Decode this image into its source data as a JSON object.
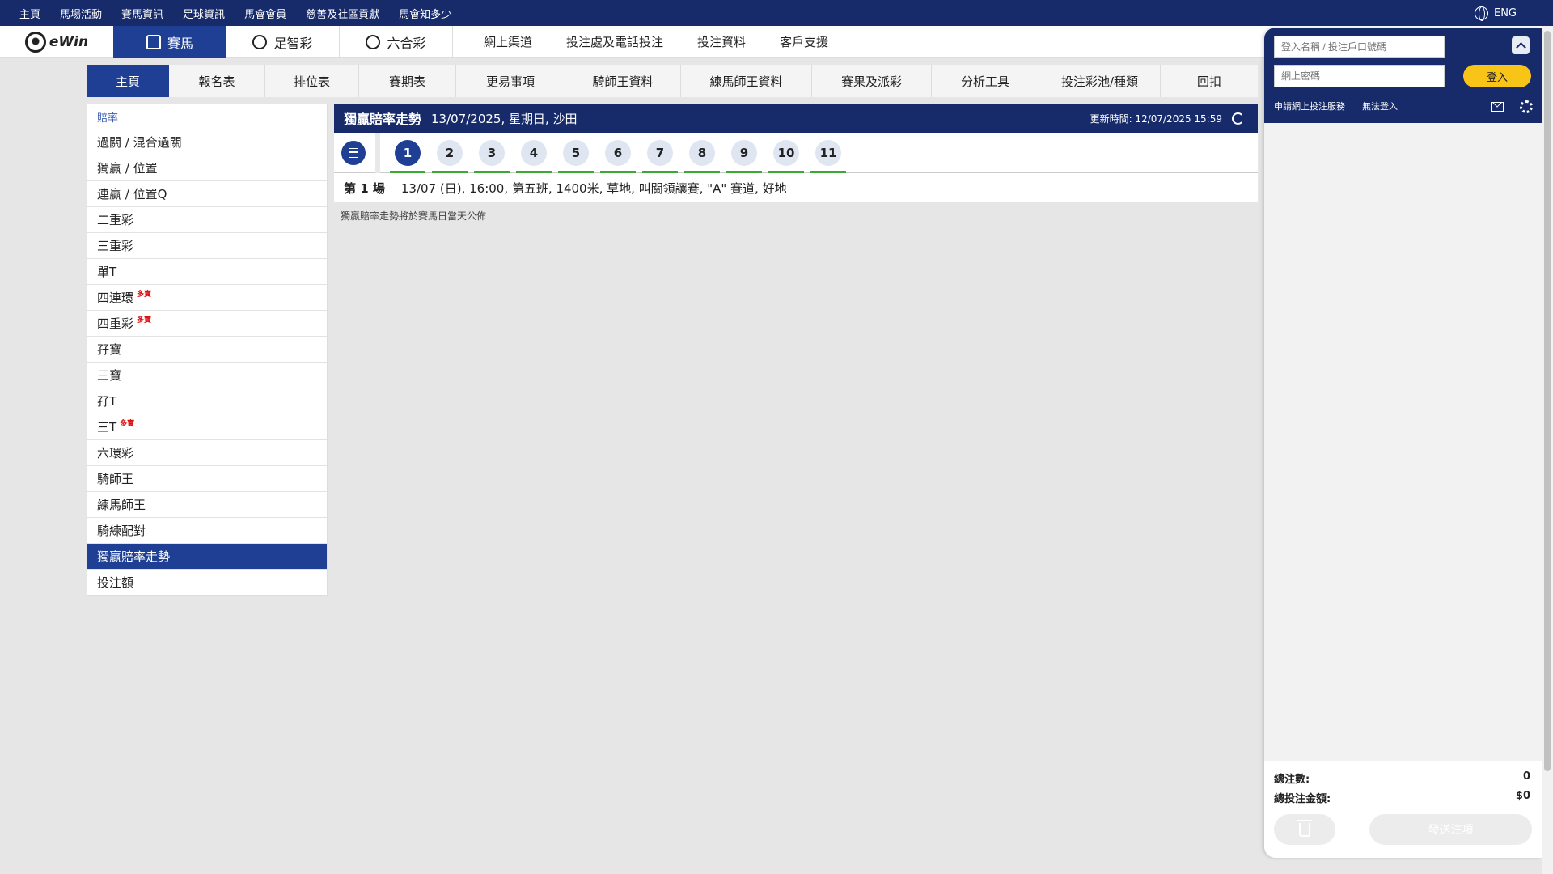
{
  "topnav": {
    "links": [
      "主頁",
      "馬場活動",
      "賽馬資訊",
      "足球資訊",
      "馬會會員",
      "慈善及社區貢獻",
      "馬會知多少"
    ],
    "lang": "ENG"
  },
  "product": {
    "logo_text": "eWin",
    "tabs": [
      "賽馬",
      "足智彩",
      "六合彩"
    ],
    "links": [
      "網上渠道",
      "投注處及電話投注",
      "投注資料",
      "客戶支援"
    ]
  },
  "subnav": [
    "主頁",
    "報名表",
    "排位表",
    "賽期表",
    "更易事項",
    "騎師王資料",
    "練馬師王資料",
    "賽果及派彩",
    "分析工具",
    "投注彩池/種類",
    "回扣"
  ],
  "sidebar": {
    "heading": "賠率",
    "items": [
      {
        "label": "過關 / 混合過關",
        "badge": ""
      },
      {
        "label": "獨贏 / 位置",
        "badge": ""
      },
      {
        "label": "連贏 / 位置Q",
        "badge": ""
      },
      {
        "label": "二重彩",
        "badge": ""
      },
      {
        "label": "三重彩",
        "badge": ""
      },
      {
        "label": "單T",
        "badge": ""
      },
      {
        "label": "四連環",
        "badge": "多寶"
      },
      {
        "label": "四重彩",
        "badge": "多寶"
      },
      {
        "label": "孖寶",
        "badge": ""
      },
      {
        "label": "三寶",
        "badge": ""
      },
      {
        "label": "孖T",
        "badge": ""
      },
      {
        "label": "三T",
        "badge": "多寶"
      },
      {
        "label": "六環彩",
        "badge": ""
      },
      {
        "label": "騎師王",
        "badge": ""
      },
      {
        "label": "練馬師王",
        "badge": ""
      },
      {
        "label": "騎練配對",
        "badge": ""
      },
      {
        "label": "獨贏賠率走勢",
        "badge": ""
      },
      {
        "label": "投注額",
        "badge": ""
      }
    ]
  },
  "panel": {
    "title": "獨贏賠率走勢",
    "date": "13/07/2025, 星期日, 沙田",
    "update_label": "更新時間: 12/07/2025 15:59",
    "races": [
      "1",
      "2",
      "3",
      "4",
      "5",
      "6",
      "7",
      "8",
      "9",
      "10",
      "11"
    ],
    "active_race": "1",
    "race_no": "第 1 場",
    "race_desc": "13/07 (日), 16:00, 第五班, 1400米, 草地, 叫關領讓賽, \"A\" 賽道, 好地",
    "note": "獨贏賠率走勢將於賽馬日當天公佈"
  },
  "login": {
    "username_placeholder": "登入名稱 / 投注戶口號碼",
    "password_placeholder": "網上密碼",
    "login_label": "登入",
    "apply_link": "申請網上投注服務",
    "cant_login_link": "無法登入"
  },
  "betslip": {
    "count_label": "總注數:",
    "count_value": "0",
    "amount_label": "總投注金額:",
    "amount_value": "$0",
    "send_label": "發送注項"
  },
  "colors": {
    "navy": "#172b6b",
    "accent_blue": "#1e3f94",
    "login_yellow": "#f7c417",
    "race_green": "#3aaa35"
  }
}
